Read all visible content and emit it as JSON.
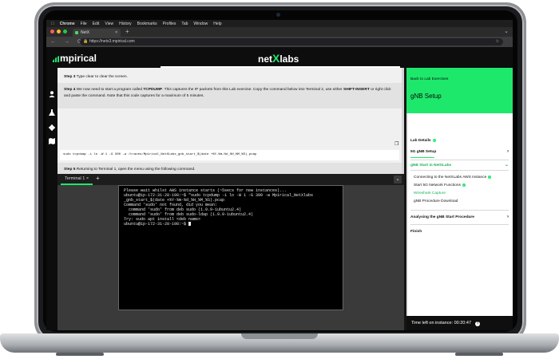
{
  "menubar": {
    "items": [
      "Chrome",
      "File",
      "Edit",
      "View",
      "History",
      "Bookmarks",
      "Profiles",
      "Tab",
      "Window",
      "Help"
    ]
  },
  "browser": {
    "tab_title": "NetX",
    "url": "https://netx3.mpirical.com",
    "new_tab": "+",
    "close_tab": "×",
    "nav": "← → ⟳"
  },
  "header": {
    "logo": "mpirical",
    "brand_left": "net",
    "brand_x": "X",
    "brand_right": "labs"
  },
  "rail_icons": [
    "user-icon",
    "flask-icon",
    "gear-icon",
    "map-icon"
  ],
  "instructions": {
    "step3": {
      "label": "Step 3",
      "text": " Type clear to clear the screen."
    },
    "step4": {
      "label": "Step 4",
      "text1": " We now need to start a program called ",
      "bold1": "TCPDUMP",
      "text2": ". This captures the IP packets from this Lab exercise. Copy the command below into Terminal 2, use either ",
      "bold2": "SHIFT-INSERT",
      "text3": " or right click and paste the command. Note that this code captures for a maximum of 5 minutes."
    },
    "command": "sudo tcpdump -i lo -W 1 -G 300 -w /traces/Mpirical_NetXLabs_gnb_start_$(date +%Y-%m-%d_%H_%M_%S).pcap",
    "step5": {
      "label": "Step 5",
      "text": " Returning to Terminal 1, open the menu using the following command."
    }
  },
  "terminal": {
    "tab_label": "Terminal 1",
    "tab_close": "×",
    "add_tab": "+",
    "dropdown": "⌄",
    "lines": [
      "Please wait whilst AWS instance starts (~5secs for new instances)...",
      "ubuntu@ip-172-31-28-198:~$ \"sudo tcpdump -i lo -W 1 -G 300 -w Mpirical_NetXlabs",
      "_gnb_start_$(date +%Y-%m-%d_%H_%M_%S).pcap",
      "Command 'sudo' not found, did you mean:",
      "  command 'sudo' from deb sudo (1.9.9-1ubuntu2.4)",
      "  command 'sudo' from deb sudo-ldap (1.9.9-1ubuntu2.4)",
      "Try: sudo apt install <deb name>",
      "ubuntu@ip-172-31-28-198:~$ "
    ]
  },
  "panel": {
    "back": "Back to Lab Exercises",
    "title": "gNB Setup",
    "items": [
      {
        "label": "Lab Details"
      },
      {
        "label": "5G gNB Setup"
      },
      {
        "label": "gNB Start in NetXLabs"
      },
      {
        "label": "Connecting to the NetXLabs AWS Instance"
      },
      {
        "label": "Start 5G Network Functions"
      },
      {
        "label": "Wireshark Capture"
      },
      {
        "label": "gNB Procedure Download"
      },
      {
        "label": "Analysing the gNB Start Procedure"
      },
      {
        "label": "Finish"
      }
    ],
    "timer_label": "Time left on instance: 00:20:47",
    "help": "?"
  },
  "colors": {
    "accent": "#1ee86b",
    "bg_dark": "#0d0d0d",
    "instructions_bg": "#f0f0f0"
  }
}
